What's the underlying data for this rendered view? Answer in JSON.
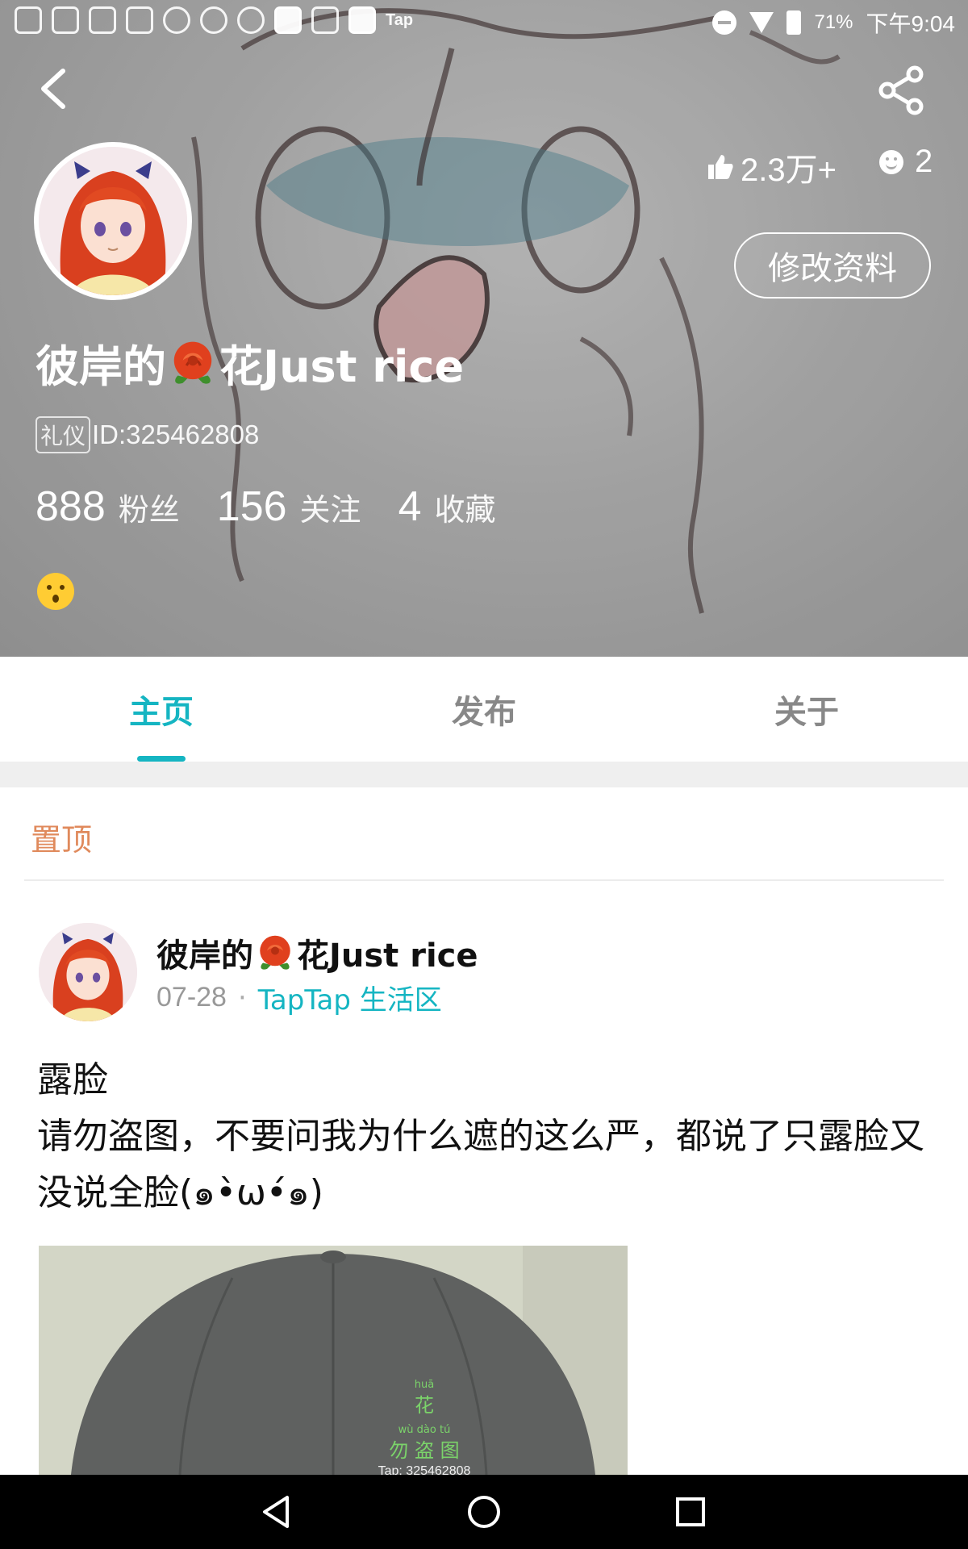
{
  "status_bar": {
    "app_label": "Tap",
    "battery": "71%",
    "time": "下午9:04"
  },
  "header": {
    "username_prefix": "彼岸的",
    "username_suffix": "花Just rice",
    "badge": "礼仪",
    "id_text": "ID:325462808",
    "likes": "2.3万+",
    "moods": "2",
    "edit_label": "修改资料",
    "counts": [
      {
        "num": "888",
        "label": "粉丝"
      },
      {
        "num": "156",
        "label": "关注"
      },
      {
        "num": "4",
        "label": "收藏"
      }
    ],
    "emoji": "kissing-face-icon"
  },
  "tabs": [
    {
      "label": "主页",
      "active": true
    },
    {
      "label": "发布",
      "active": false
    },
    {
      "label": "关于",
      "active": false
    }
  ],
  "feed": {
    "pinned_label": "置顶",
    "post": {
      "author_prefix": "彼岸的",
      "author_suffix": "花Just rice",
      "date": "07-28",
      "separator": "·",
      "forum": "TapTap 生活区",
      "title": "露脸",
      "body": "请勿盗图，不要问我为什么遮的这么严，都说了只露脸又没说全脸(๑•̀ω•́๑)",
      "image_watermark": {
        "pinyin_top": "huā",
        "char_top": "花",
        "pinyin_bottom": "wù  dào  tú",
        "chars_bottom": "勿 盗 图",
        "tap_line": "Tap: 325462808"
      }
    }
  },
  "colors": {
    "accent": "#15b5c2",
    "pinned": "#e08a5c",
    "header_bg": "#b3b3b3"
  }
}
